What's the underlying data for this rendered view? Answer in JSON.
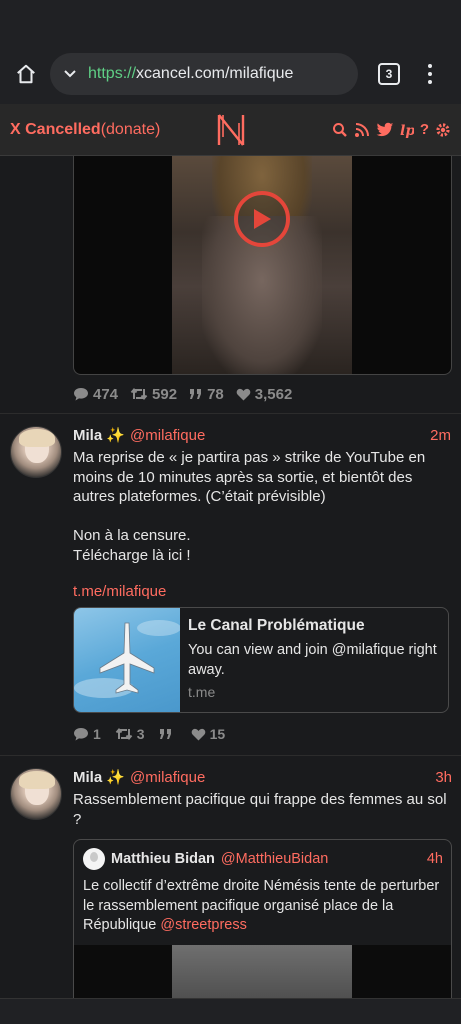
{
  "browser": {
    "url_scheme": "https://",
    "url_host": "xcancel.com/milafique",
    "tab_count": "3"
  },
  "site": {
    "brand_name": "X Cancelled",
    "brand_donate": "(donate)",
    "logo_letter": "N",
    "accent_color": "#ff6c60",
    "nav_icons": [
      "search-icon",
      "rss-icon",
      "twitter-icon",
      "liberapay-icon",
      "help-icon",
      "settings-icon"
    ],
    "help_glyph": "?"
  },
  "tweets": [
    {
      "stats": {
        "replies": "474",
        "retweets": "592",
        "quotes": "78",
        "likes": "3,562"
      }
    },
    {
      "display_name": "Mila ✨",
      "username": "@milafique",
      "date": "2m",
      "text": "Ma reprise de « je partira pas » strike de YouTube en moins de 10 minutes après sa sortie, et bientôt des autres plateformes. (C’était prévisible)\n\nNon à la censure.\nTélécharge là ici !",
      "link": "t.me/milafique",
      "card": {
        "title": "Le Canal Problématique",
        "description": "You can view and join @milafique right away.",
        "destination": "t.me"
      },
      "stats": {
        "replies": "1",
        "retweets": "3",
        "quotes": "",
        "likes": "15"
      }
    },
    {
      "display_name": "Mila ✨",
      "username": "@milafique",
      "date": "3h",
      "text": "Rassemblement pacifique qui frappe des femmes au sol ?",
      "quote": {
        "display_name": "Matthieu Bidan",
        "username": "@MatthieuBidan",
        "date": "4h",
        "text": "Le collectif d’extrême droite Némésis tente de perturber le rassemblement pacifique organisé place de la République",
        "mention": "@streetpress"
      }
    }
  ]
}
